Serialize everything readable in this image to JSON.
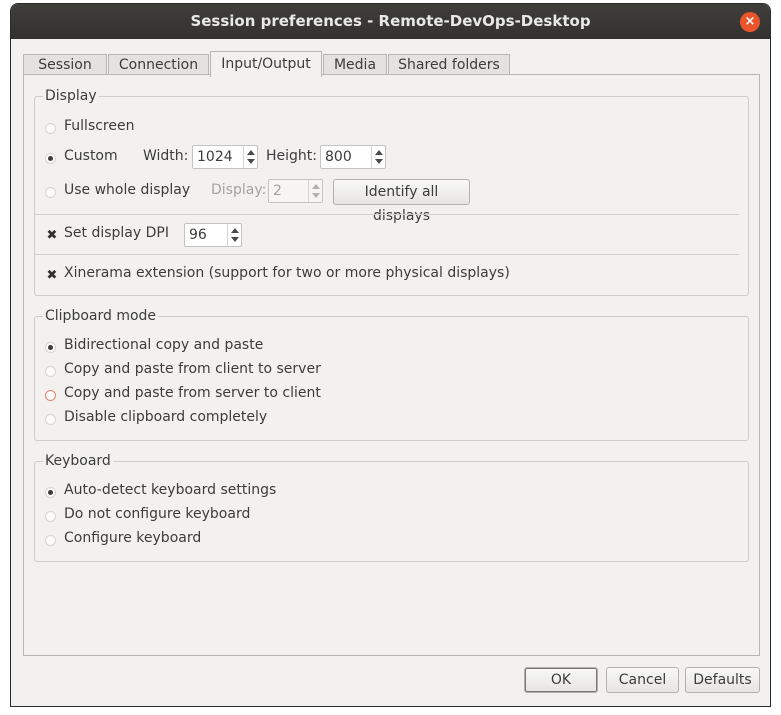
{
  "window": {
    "title": "Session preferences - Remote-DevOps-Desktop",
    "close_glyph": "×"
  },
  "tabs": [
    {
      "label": "Session",
      "active": false
    },
    {
      "label": "Connection",
      "active": false
    },
    {
      "label": "Input/Output",
      "active": true
    },
    {
      "label": "Media",
      "active": false
    },
    {
      "label": "Shared folders",
      "active": false
    }
  ],
  "display": {
    "title": "Display",
    "fullscreen_label": "Fullscreen",
    "custom_label": "Custom",
    "width_label": "Width:",
    "width_value": "1024",
    "height_label": "Height:",
    "height_value": "800",
    "whole_display_label": "Use whole display",
    "display_label": "Display:",
    "display_value": "2",
    "identify_button": "Identify all displays",
    "selected": "Custom",
    "dpi_label": "Set display DPI",
    "dpi_checked": true,
    "dpi_value": "96",
    "xinerama_label": "Xinerama extension (support for two or more physical displays)",
    "xinerama_checked": true
  },
  "clipboard": {
    "title": "Clipboard mode",
    "options": [
      "Bidirectional copy and paste",
      "Copy and paste from client to server",
      "Copy and paste from server to client",
      "Disable clipboard completely"
    ],
    "selected": "Bidirectional copy and paste"
  },
  "keyboard": {
    "title": "Keyboard",
    "options": [
      "Auto-detect keyboard settings",
      "Do not configure keyboard",
      "Configure keyboard"
    ],
    "selected": "Auto-detect keyboard settings"
  },
  "buttons": {
    "ok": "OK",
    "cancel": "Cancel",
    "defaults": "Defaults"
  },
  "check_glyph": "✖"
}
